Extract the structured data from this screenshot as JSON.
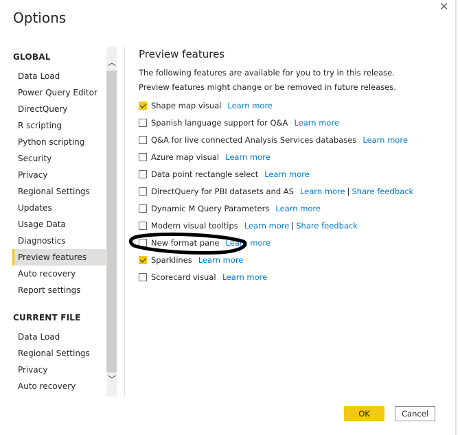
{
  "dialog": {
    "title": "Options",
    "close": "✕"
  },
  "sidebar": {
    "global_header": "GLOBAL",
    "global_items": [
      "Data Load",
      "Power Query Editor",
      "DirectQuery",
      "R scripting",
      "Python scripting",
      "Security",
      "Privacy",
      "Regional Settings",
      "Updates",
      "Usage Data",
      "Diagnostics",
      "Preview features",
      "Auto recovery",
      "Report settings"
    ],
    "selected": "Preview features",
    "current_header": "CURRENT FILE",
    "current_items": [
      "Data Load",
      "Regional Settings",
      "Privacy",
      "Auto recovery"
    ]
  },
  "main": {
    "title": "Preview features",
    "description": "The following features are available for you to try in this release. Preview features might change or be removed in future releases.",
    "features": [
      {
        "label": "Shape map visual",
        "checked": true,
        "link": "Learn more"
      },
      {
        "label": "Spanish language support for Q&A",
        "checked": false,
        "link": "Learn more"
      },
      {
        "label": "Q&A for live connected Analysis Services databases",
        "checked": false,
        "link": "Learn more"
      },
      {
        "label": "Azure map visual",
        "checked": false,
        "link": "Learn more"
      },
      {
        "label": "Data point rectangle select",
        "checked": false,
        "link": "Learn more"
      },
      {
        "label": "DirectQuery for PBI datasets and AS",
        "checked": false,
        "link": "Learn more",
        "link2": "Share feedback"
      },
      {
        "label": "Dynamic M Query Parameters",
        "checked": false,
        "link": "Learn more"
      },
      {
        "label": "Modern visual tooltips",
        "checked": false,
        "link": "Learn more",
        "link2": "Share feedback"
      },
      {
        "label": "New format pane",
        "checked": false,
        "link": "Learn more"
      },
      {
        "label": "Sparklines",
        "checked": true,
        "link": "Learn more"
      },
      {
        "label": "Scorecard visual",
        "checked": false,
        "link": "Learn more"
      }
    ],
    "separator": "|"
  },
  "footer": {
    "ok": "OK",
    "cancel": "Cancel"
  },
  "colors": {
    "accent": "#f2c811",
    "link": "#0078d4"
  }
}
